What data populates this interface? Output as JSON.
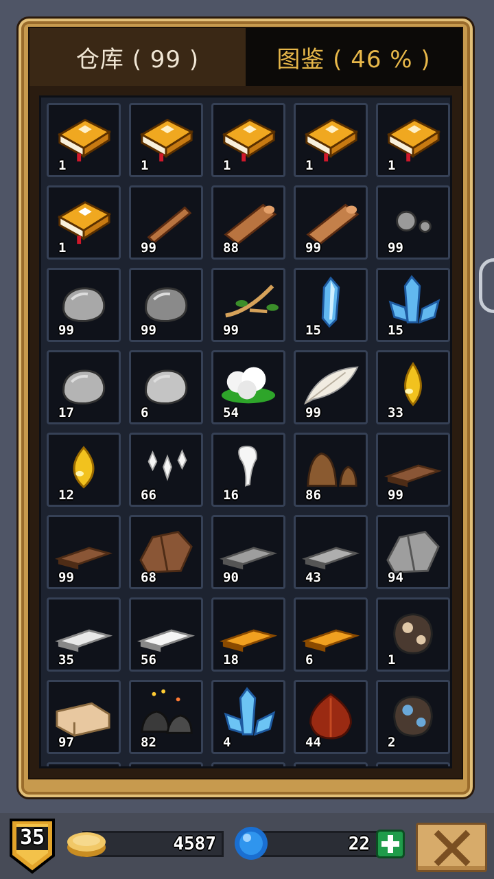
{
  "tabs": [
    {
      "label": "仓库 ( 99 )",
      "active": true
    },
    {
      "label": "图鉴 ( 46 % )",
      "active": false
    }
  ],
  "items": [
    {
      "icon": "book-yellow-icon",
      "qty": "1"
    },
    {
      "icon": "book-yellow-icon",
      "qty": "1"
    },
    {
      "icon": "book-yellow-icon",
      "qty": "1"
    },
    {
      "icon": "book-yellow-icon",
      "qty": "1"
    },
    {
      "icon": "book-yellow-icon",
      "qty": "1"
    },
    {
      "icon": "book-white-emblem-icon",
      "qty": "1"
    },
    {
      "icon": "stick-icon",
      "qty": "99"
    },
    {
      "icon": "wood-log-icon",
      "qty": "88"
    },
    {
      "icon": "big-wood-log-icon",
      "qty": "99"
    },
    {
      "icon": "pebbles-icon",
      "qty": "99"
    },
    {
      "icon": "stone-icon",
      "qty": "99"
    },
    {
      "icon": "boulder-icon",
      "qty": "99"
    },
    {
      "icon": "branch-icon",
      "qty": "99"
    },
    {
      "icon": "blue-crystal-icon",
      "qty": "15"
    },
    {
      "icon": "crystal-cluster-icon",
      "qty": "15"
    },
    {
      "icon": "ore-chunk-icon",
      "qty": "17"
    },
    {
      "icon": "ore-rock-icon",
      "qty": "6"
    },
    {
      "icon": "cotton-icon",
      "qty": "54"
    },
    {
      "icon": "feather-icon",
      "qty": "99"
    },
    {
      "icon": "yellow-drop-icon",
      "qty": "33"
    },
    {
      "icon": "big-yellow-drop-icon",
      "qty": "12"
    },
    {
      "icon": "white-fangs-icon",
      "qty": "66"
    },
    {
      "icon": "white-tooth-icon",
      "qty": "16"
    },
    {
      "icon": "brown-pile-icon",
      "qty": "86"
    },
    {
      "icon": "brown-bar-icon",
      "qty": "99"
    },
    {
      "icon": "brown-ingot-icon",
      "qty": "99"
    },
    {
      "icon": "brown-block-icon",
      "qty": "68"
    },
    {
      "icon": "iron-bar-icon",
      "qty": "90"
    },
    {
      "icon": "iron-ingot-icon",
      "qty": "43"
    },
    {
      "icon": "iron-block-icon",
      "qty": "94"
    },
    {
      "icon": "silver-bar-icon",
      "qty": "35"
    },
    {
      "icon": "silver-ingot-icon",
      "qty": "56"
    },
    {
      "icon": "gold-bar-icon",
      "qty": "18"
    },
    {
      "icon": "gold-ingot-icon",
      "qty": "6"
    },
    {
      "icon": "dark-ore-icon",
      "qty": "1"
    },
    {
      "icon": "sandstone-brick-icon",
      "qty": "97"
    },
    {
      "icon": "coal-icon",
      "qty": "82"
    },
    {
      "icon": "ice-crystal-icon",
      "qty": "4"
    },
    {
      "icon": "red-bulb-icon",
      "qty": "44"
    },
    {
      "icon": "blue-ore-icon",
      "qty": "2"
    }
  ],
  "player": {
    "level": "35",
    "gold": "4587",
    "gems": "22"
  },
  "icons": {
    "coin": "gold-coin-icon",
    "gem": "blue-gem-icon",
    "add": "plus-icon",
    "close": "close-icon",
    "level": "level-shield-icon"
  }
}
